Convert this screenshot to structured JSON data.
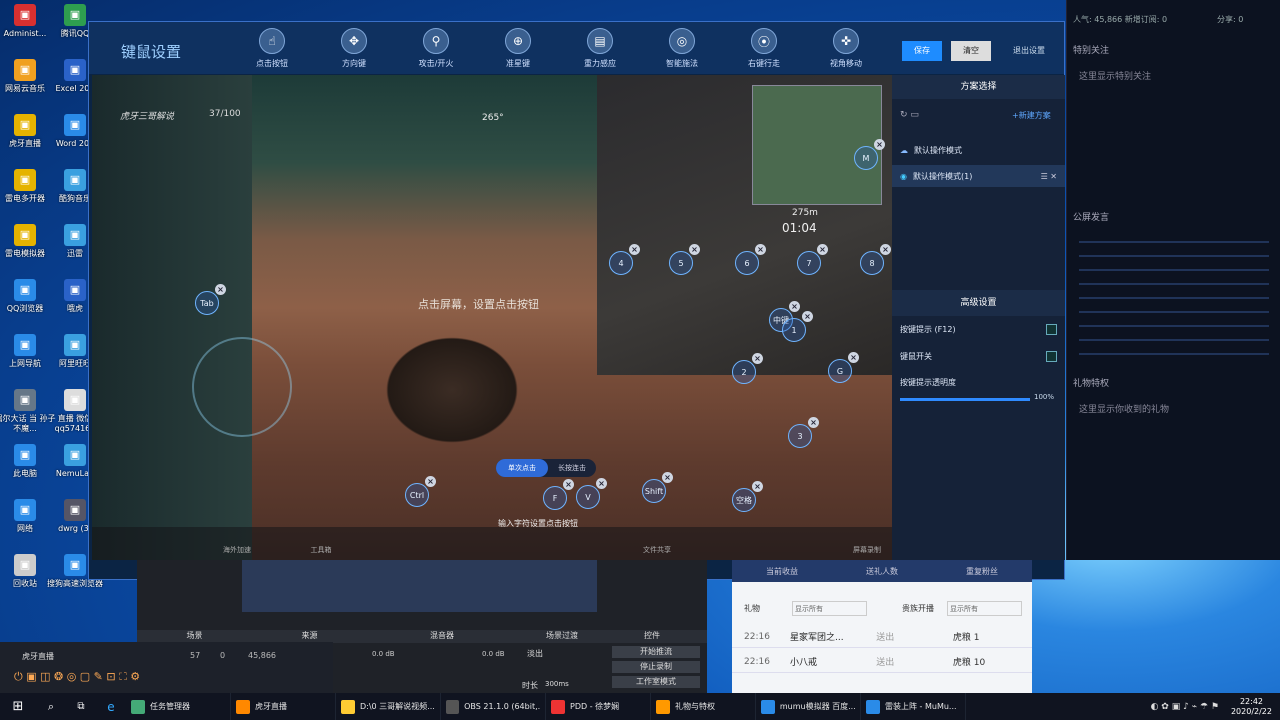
{
  "desktop_icons": [
    "Administ...",
    "腾讯QQ",
    "网易云音乐",
    "Excel 201",
    "虎牙直播",
    "Word 201",
    "雷电多开器",
    "酷狗音乐",
    "雷电模拟器",
    "迅雷",
    "QQ浏览器",
    "哦虎",
    "上网导航",
    "阿里旺旺",
    "偶尔大话 当 孙子 不魔...",
    "直播 微信 qq574165",
    "此电脑",
    "NemuLau",
    "网络",
    "dwrg (3)",
    "回收站",
    "搜狗高速浏览器"
  ],
  "right_sidebar": {
    "stats": "人气: 45,866  新增订阅: 0",
    "share": "分享: 0",
    "follow_title": "特别关注",
    "follow_empty": "这里显示特别关注",
    "announce": "公屏发言",
    "gifts": "礼物特权",
    "gift_line": "这里显示你收到的礼物"
  },
  "window": {
    "title": "键鼠设置",
    "save": "保存",
    "clear": "清空",
    "exit": "退出设置",
    "tools": [
      "点击按钮",
      "方向键",
      "攻击/开火",
      "准星键",
      "重力感应",
      "智能施法",
      "右键行走",
      "视角移动"
    ],
    "game_hint": "点击屏幕，设置点击按钮",
    "single_click": "单次点击",
    "long_press": "长按连击",
    "input_hint": "输入字符设置点击按钮",
    "hud_count": "37/100",
    "hud_team": "虎牙三哥解说",
    "hud_dist": "275m",
    "hud_timer": "01:04",
    "compass": "265°",
    "bottom_bar": [
      "海外加速",
      "",
      "工具箱",
      "",
      "",
      "",
      "",
      "",
      "",
      "",
      "文件共享",
      "",
      "",
      "",
      "",
      "屏幕录制"
    ]
  },
  "panel": {
    "scheme_title": "方案选择",
    "new_scheme": "+新建方案",
    "scheme_default": "默认操作模式",
    "scheme_active": "默认操作模式(1)",
    "adv_title": "高级设置",
    "key_hint": "按键提示 (F12)",
    "mouse_lock": "键鼠开关",
    "opacity_label": "按键提示透明度",
    "opacity_value": "100%",
    "opacity": 1.0
  },
  "keys": [
    "M",
    "4",
    "5",
    "6",
    "7",
    "8",
    "Tab",
    "中键",
    "1",
    "2",
    "G",
    "3",
    "Shift",
    "空格",
    "Ctrl",
    "F",
    "V"
  ],
  "taskbar": {
    "items": [
      "任务管理器",
      "虎牙直播",
      "D:\\0 三哥解说视频...",
      "OBS 21.1.0 (64bit,...",
      "PDD - 徐梦娴",
      "礼物与特权",
      "mumu模拟器 百度...",
      "雷装上阵 - MuMu..."
    ],
    "time": "22:42",
    "date": "2020/2/22"
  },
  "obs": {
    "scene": "场景",
    "source": "来源",
    "mixer": "混音器",
    "transition": "场景过渡",
    "controls": "控件",
    "start_stream": "开始推流",
    "stop_record": "停止录制",
    "studio": "工作室模式",
    "fade": "淡出",
    "duration": "时长",
    "duration_val": "300ms",
    "db1": "0.0 dB",
    "db2": "0.0 dB"
  },
  "huya_bar": {
    "name": "虎牙直播",
    "likes": "57",
    "fans": "0",
    "pop": "45,866"
  },
  "gift_panel": {
    "tabs": [
      "当前收益",
      "送礼人数",
      "重复粉丝"
    ],
    "gift_label": "礼物",
    "show_all": "显示所有",
    "noble": "贵族开播",
    "rows": [
      {
        "time": "22:16",
        "user": "星家军团之...",
        "action": "送出",
        "item": "虎粮 1"
      },
      {
        "time": "22:16",
        "user": "小八戒",
        "action": "送出",
        "item": "虎粮 10"
      }
    ]
  }
}
